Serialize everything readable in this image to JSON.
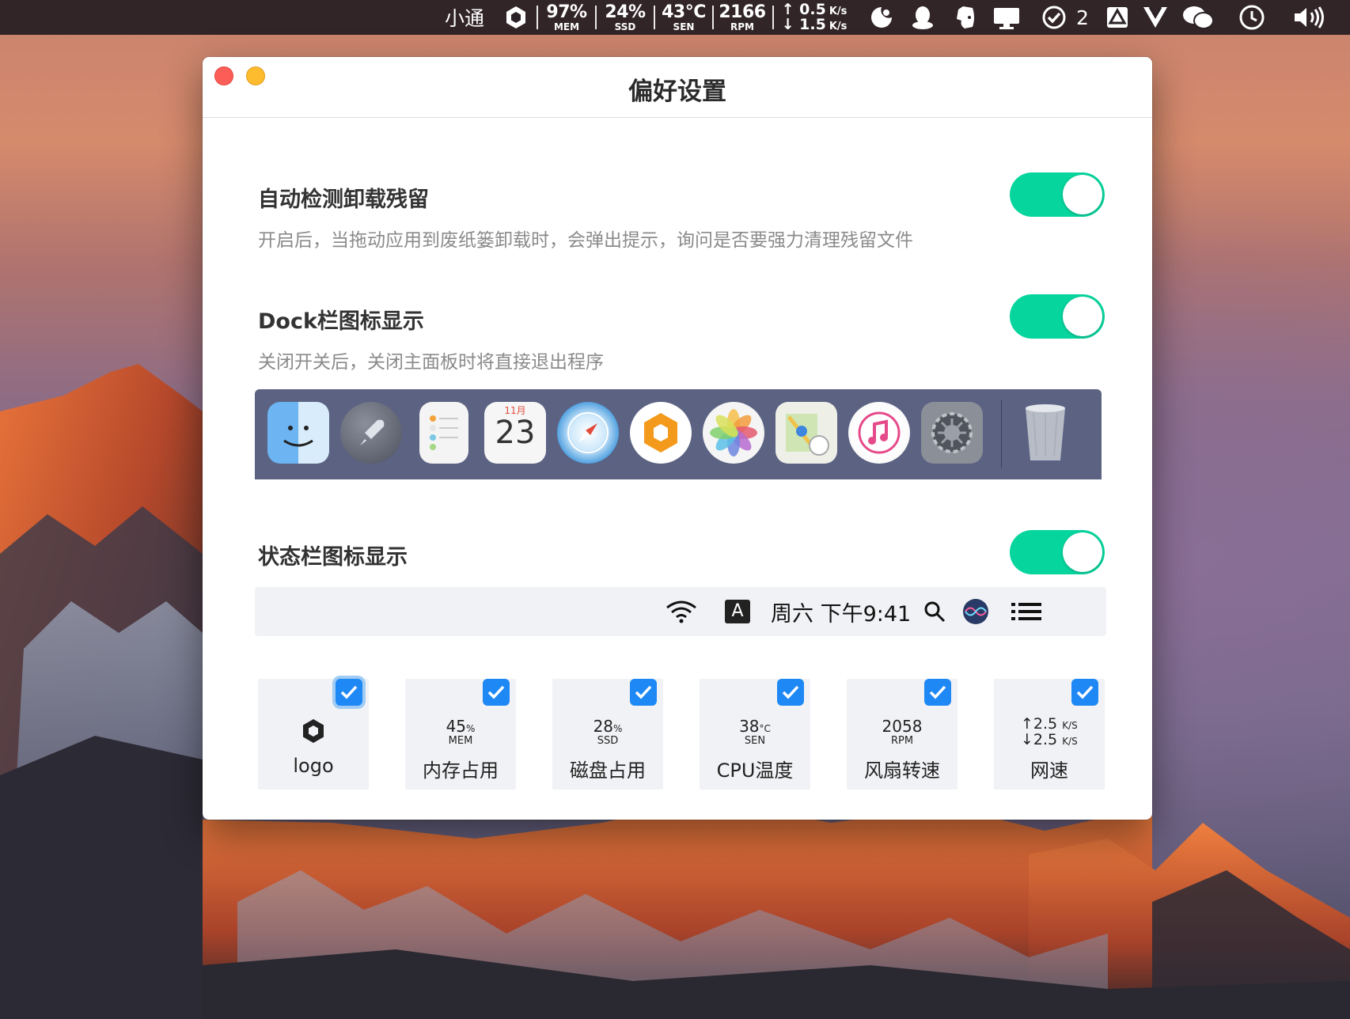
{
  "menubar": {
    "app_text": "小通",
    "mem": {
      "value": "97%",
      "unit": "MEM"
    },
    "ssd": {
      "value": "24%",
      "unit": "SSD"
    },
    "sen": {
      "value": "43°C",
      "unit": "SEN"
    },
    "rpm": {
      "value": "2166",
      "unit": "RPM"
    },
    "net_up": "0.5",
    "net_down": "1.5",
    "net_unit": "K/s",
    "task_count": "2"
  },
  "window": {
    "title": "偏好设置"
  },
  "settings": {
    "auto_detect": {
      "title": "自动检测卸载残留",
      "desc": "开启后，当拖动应用到废纸篓卸载时，会弹出提示，询问是否要强力清理残留文件",
      "enabled": true
    },
    "dock_icon": {
      "title": "Dock栏图标显示",
      "desc": "关闭开关后，关闭主面板时将直接退出程序",
      "enabled": true
    },
    "status_icon": {
      "title": "状态栏图标显示",
      "enabled": true
    }
  },
  "dock_preview": {
    "calendar_month": "11月",
    "calendar_day": "23",
    "apps": [
      "finder",
      "launchpad",
      "reminders",
      "calendar",
      "safari",
      "app-logo",
      "photos",
      "maps",
      "itunes",
      "system-preferences",
      "trash"
    ]
  },
  "statusbar_preview": {
    "input_label": "A",
    "datetime": "周六 下午9:41"
  },
  "cards": [
    {
      "label": "logo",
      "checked": true
    },
    {
      "label": "内存占用",
      "value": "45",
      "suffix": "%",
      "unit": "MEM",
      "checked": true
    },
    {
      "label": "磁盘占用",
      "value": "28",
      "suffix": "%",
      "unit": "SSD",
      "checked": true
    },
    {
      "label": "CPU温度",
      "value": "38",
      "suffix": "°C",
      "unit": "SEN",
      "checked": true
    },
    {
      "label": "风扇转速",
      "value": "2058",
      "suffix": "",
      "unit": "RPM",
      "checked": true
    },
    {
      "label": "网速",
      "up": "2.5",
      "down": "2.5",
      "unit": "K/S",
      "checked": true
    }
  ],
  "colors": {
    "toggle_on": "#06d59d",
    "checkbox": "#1e88f5",
    "dock_bg": "#5b6282"
  }
}
